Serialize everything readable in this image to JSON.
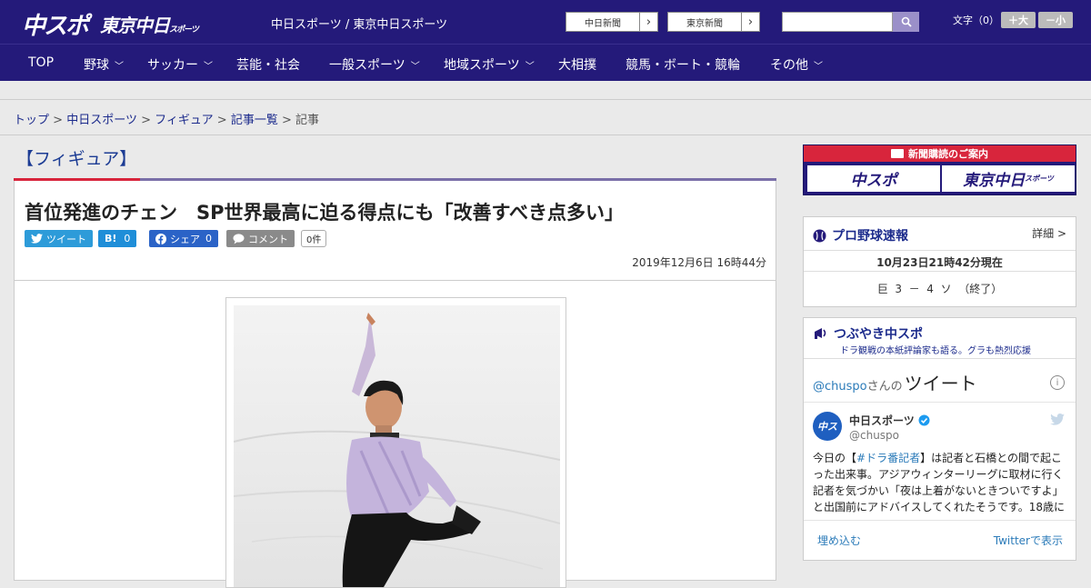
{
  "header": {
    "logo_main": "中スポ",
    "logo_tokyo": "東京中日",
    "logo_tokyo_small": "スポーツ",
    "site_title": "中日スポーツ / 東京中日スポーツ",
    "paper_buttons": [
      "中日新聞",
      "東京新聞"
    ],
    "font_size_label": "文字（0）",
    "font_bigger": "＋大",
    "font_smaller": "－小"
  },
  "nav": {
    "items": [
      {
        "label": "TOP",
        "has_menu": false
      },
      {
        "label": "野球",
        "has_menu": true
      },
      {
        "label": "サッカー",
        "has_menu": true
      },
      {
        "label": "芸能・社会",
        "has_menu": false
      },
      {
        "label": "一般スポーツ",
        "has_menu": true
      },
      {
        "label": "地域スポーツ",
        "has_menu": true
      },
      {
        "label": "大相撲",
        "has_menu": false
      },
      {
        "label": "競馬・ボート・競輪",
        "has_menu": false
      },
      {
        "label": "その他",
        "has_menu": true
      }
    ]
  },
  "breadcrumb": {
    "items": [
      "トップ",
      "中日スポーツ",
      "フィギュア",
      "記事一覧"
    ],
    "current": "記事",
    "separator": ">"
  },
  "section": {
    "title": "【フィギュア】"
  },
  "article": {
    "headline": "首位発進のチェン　SP世界最高に迫る得点にも「改善すべき点多い」",
    "share": {
      "tweet": "ツイート",
      "hatena_label": "B!",
      "hatena_count": "0",
      "facebook_label": "シェア",
      "facebook_count": "0",
      "comment_label": "コメント",
      "comment_count": "0件"
    },
    "date": "2019年12月6日 16時44分"
  },
  "sidebar": {
    "subscription": {
      "head": "新聞購読のご案内",
      "left": "中スポ",
      "right": "東京中日",
      "right_small": "スポーツ"
    },
    "baseball": {
      "title": "プロ野球速報",
      "detail_link": "詳細 >",
      "updated": "10月23日21時42分現在",
      "score": "巨  3  －  4  ソ  （終了）"
    },
    "tsubuyaki": {
      "title": "つぶやき中スポ",
      "subtitle": "ドラ観戦の本紙評論家も語る。グラも熱烈応援"
    },
    "twitter": {
      "handle_prefix": "@chuspo",
      "handle_suffix": "さんの",
      "tweets_label": "ツイート",
      "account_name": "中日スポーツ",
      "account_handle": "@chuspo",
      "tweet_pre": "今日の【",
      "tweet_tag": "#ドラ番記者",
      "tweet_post": "】は記者と石橋との間で起こった出来事。アジアウィンターリーグに取材に行く記者を気づかい「夜は上着がないときついですよ」と出国前にアドバイスしてくれたそうです。18歳に",
      "embed": "埋め込む",
      "view_on_twitter": "Twitterで表示"
    }
  },
  "colors": {
    "brand_navy": "#241a7a",
    "accent_red": "#d8253c",
    "link_blue": "#1c2b8c"
  }
}
